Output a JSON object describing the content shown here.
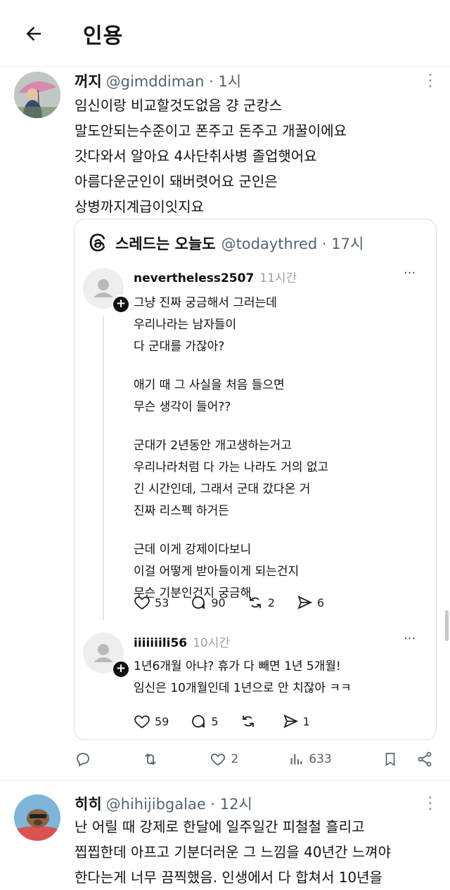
{
  "header": {
    "title": "인용"
  },
  "post1": {
    "display_name": "꺼지",
    "handle": "@gimddiman · 1시",
    "lines": [
      "임신이랑 비교할것도없음 걍 군캉스",
      "말도안되는수준이고 폰주고 돈주고 개꿀이에요",
      "갓다와서 알아요 4사단취사병 졸업햇어요",
      "아름다운군인이 돼버렷어요 군인은",
      "상병까지계급이잇지요"
    ],
    "more": "⋮",
    "actions": {
      "likes": "2",
      "views": "633"
    }
  },
  "quote": {
    "account_name": "스레드는 오늘도",
    "account_handle": "@todaythred · 17시",
    "thread1": {
      "user": "nevertheless2507",
      "time": "11시간",
      "paragraphs": [
        [
          "그냥 진짜 궁금해서 그러는데",
          "우리나라는 남자들이",
          "다 군대를 가잖아?"
        ],
        [
          "애기 때 그 사실을 처음 들으면",
          "무슨 생각이 들어??"
        ],
        [
          "군대가 2년동안 개고생하는거고",
          "우리나라처럼 다 가는 나라도 거의 없고",
          "긴 시간인데, 그래서 군대 갔다온 거",
          "진짜 리스펙 하거든"
        ],
        [
          "근데 이게 강제이다보니",
          "이걸 어떻게 받아들이게 되는건지",
          "무슨 기분인건지 궁금해"
        ]
      ],
      "likes": "53",
      "replies": "90",
      "reposts": "2",
      "shares": "6",
      "more": "···"
    },
    "thread2": {
      "user": "iiiiiiili56",
      "time": "10시간",
      "lines": [
        "1년6개월 아냐? 휴가 다 빼면 1년 5개월!",
        "임신은 10개월인데 1년으로 안 치잖아 ㅋㅋ"
      ],
      "likes": "59",
      "replies": "5",
      "reposts": "",
      "shares": "1",
      "more": "···"
    }
  },
  "post2": {
    "display_name": "히히",
    "handle": "@hihijibgalae · 12시",
    "more": "⋮",
    "lines": [
      "난 어릴 때 강제로 한달에 일주일간 피철철 흘리고",
      "찝찝한데 아프고 기분더러운 그 느낌을 40년간 느껴야",
      "한다는게 너무 끔찍했음. 인생에서 다 합쳐서 10년을"
    ]
  },
  "colors": {
    "accent": "#0f1419",
    "muted": "#536471",
    "threads_gray": "#9aa0a6"
  }
}
